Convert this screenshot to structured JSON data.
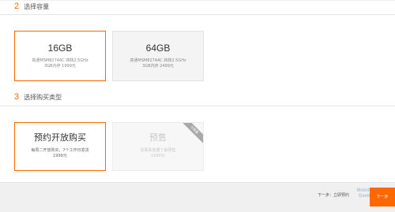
{
  "sections": {
    "capacity": {
      "number": "2",
      "title": "选择容量"
    },
    "purchase": {
      "number": "3",
      "title": "选择购买类型"
    }
  },
  "capacity_options": [
    {
      "title": "16GB",
      "line1": "高通MSM8274AC 四核2.5GHz",
      "line2": "3GB内存 1999元",
      "state": "selected"
    },
    {
      "title": "64GB",
      "line1": "高通MSM8274AC 四核2.5GHz",
      "line2": "3GB内存 2499元",
      "state": "normal"
    }
  ],
  "purchase_options": [
    {
      "title": "预约开放购买",
      "line1": "每周二开放购买，7个工作日发货",
      "line2": "1999元",
      "state": "selected"
    },
    {
      "title": "预售",
      "line1": "请联系客服了解预售",
      "line2": "1999元",
      "state": "disabled",
      "ribbon": "已售罄"
    }
  ],
  "footer": {
    "prev_label": "下一步：立即预约",
    "next_label": "下一步",
    "watermark": "Mobile Geek"
  },
  "colors": {
    "accent": "#ff6700",
    "selected_border": "#ff6700",
    "disabled_text": "#c9c9c9"
  }
}
